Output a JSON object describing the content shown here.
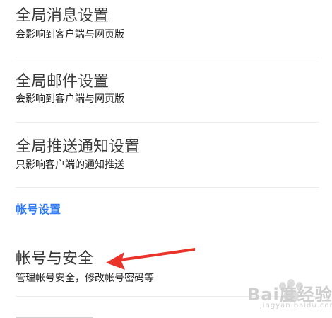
{
  "settings": {
    "items": [
      {
        "title": "全局消息设置",
        "subtitle": "会影响到客户端与网页版"
      },
      {
        "title": "全局邮件设置",
        "subtitle": "会影响到客户端与网页版"
      },
      {
        "title": "全局推送通知设置",
        "subtitle": "只影响客户端的通知推送"
      }
    ],
    "section_header": "帐号设置",
    "account_item": {
      "title": "帐号与安全",
      "subtitle": "管理帐号安全，修改帐号密码等"
    }
  },
  "annotation": {
    "color": "#e8342b"
  },
  "watermark": {
    "brand": "Bai度经验",
    "domain": "jingyan.baidu.com"
  },
  "colors": {
    "accent": "#2f7bf5",
    "title_text": "#3a3a3a",
    "divider": "#ececec"
  }
}
